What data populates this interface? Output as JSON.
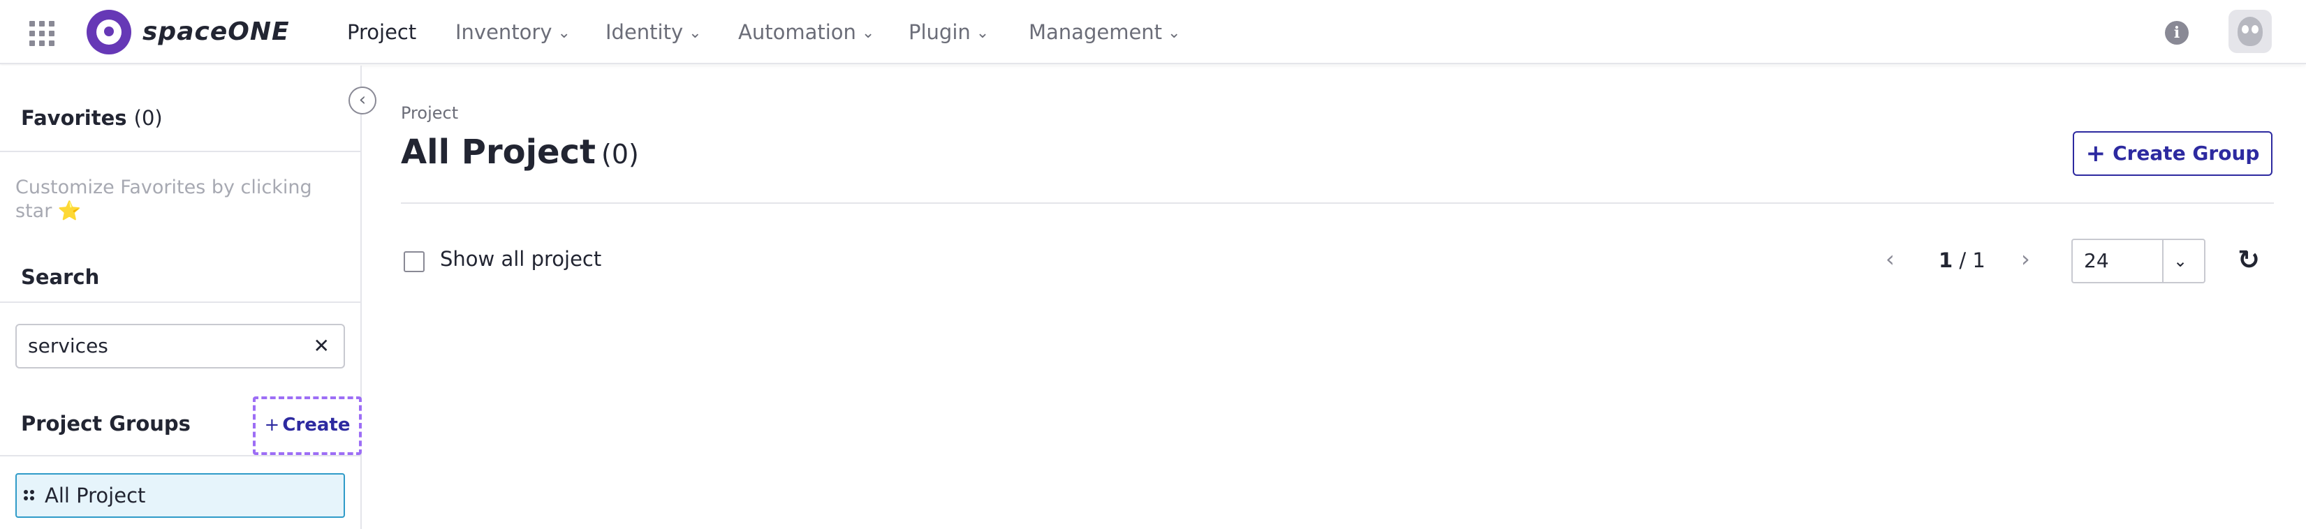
{
  "app": {
    "brand": "spaceONE"
  },
  "nav": {
    "items": [
      {
        "label": "Project",
        "active": true,
        "has_menu": false
      },
      {
        "label": "Inventory",
        "active": false,
        "has_menu": true
      },
      {
        "label": "Identity",
        "active": false,
        "has_menu": true
      },
      {
        "label": "Automation",
        "active": false,
        "has_menu": true
      },
      {
        "label": "Plugin",
        "active": false,
        "has_menu": true
      },
      {
        "label": "Management",
        "active": false,
        "has_menu": true
      }
    ],
    "chevron": "⌄",
    "info_icon_glyph": "i"
  },
  "sidebar": {
    "collapse_glyph": "‹",
    "favorites": {
      "title": "Favorites",
      "count": "(0)",
      "hint": "Customize Favorites by clicking star ⭐"
    },
    "search": {
      "title": "Search",
      "value": "services",
      "clear_glyph": "✕"
    },
    "project_groups": {
      "title": "Project Groups",
      "create_plus": "+",
      "create_label": "Create",
      "items": [
        {
          "label": "All Project",
          "selected": true
        }
      ]
    }
  },
  "main": {
    "breadcrumb": "Project",
    "title": "All Project",
    "title_count": "(0)",
    "create_group_plus": "+",
    "create_group_label": "Create Group",
    "show_all_label": "Show all project",
    "show_all_checked": false,
    "pagination": {
      "prev_glyph": "‹",
      "next_glyph": "›",
      "current": "1",
      "separator": " / ",
      "total": "1"
    },
    "page_size": {
      "value": "24",
      "arrow_glyph": "⌄"
    },
    "refresh_glyph": "↻"
  },
  "colors": {
    "brand_purple": "#6638b6",
    "primary_indigo": "#2d2aa0",
    "selection_border": "#2f9bc8",
    "selection_bg": "#e6f4fb",
    "highlight_dashed": "#9d6ef5"
  }
}
